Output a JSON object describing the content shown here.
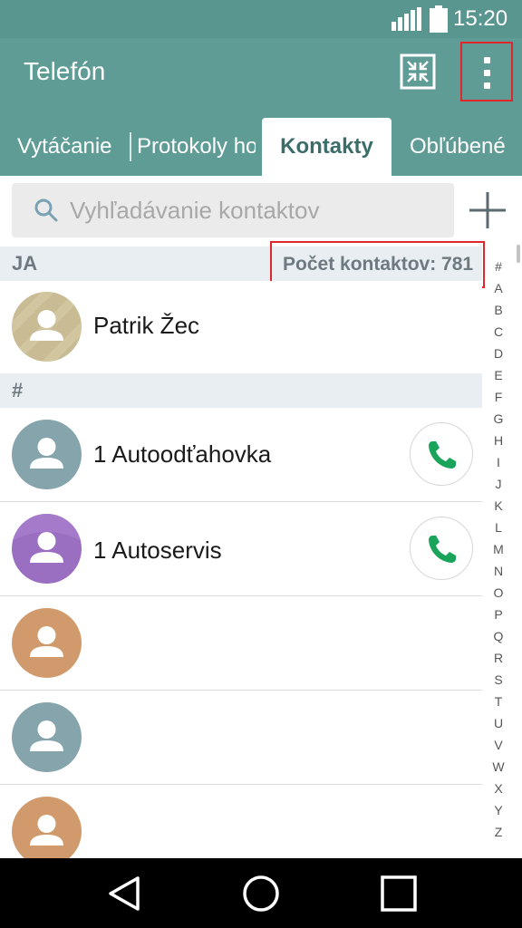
{
  "status_bar": {
    "time": "15:20"
  },
  "app_bar": {
    "title": "Telefón",
    "collapse_icon": "collapse-arrows-icon",
    "menu_icon": "more-vert-icon"
  },
  "tabs": [
    {
      "label": "Vytáčanie",
      "active": false
    },
    {
      "label": "Protokoly hovorov",
      "active": false
    },
    {
      "label": "Kontakty",
      "active": true
    },
    {
      "label": "Obľúbené",
      "active": false
    }
  ],
  "search": {
    "placeholder": "Vyhľadávanie kontaktov",
    "value": ""
  },
  "sections": [
    {
      "letter": "JA",
      "count_label": "Počet kontaktov: 781"
    },
    {
      "letter": "#"
    }
  ],
  "contacts": [
    {
      "name": "Patrik Žec",
      "avatar_color": "#c9bc94",
      "has_call": false
    },
    {
      "name": "1 Autoodťahovka",
      "avatar_color": "#86a4ac",
      "has_call": true
    },
    {
      "name": "1 Autoservis",
      "avatar_color": "#9a6ec0",
      "has_call": true
    },
    {
      "name": "",
      "avatar_color": "#d09a6c",
      "has_call": false
    },
    {
      "name": "",
      "avatar_color": "#86a4ac",
      "has_call": false
    },
    {
      "name": "",
      "avatar_color": "#d09a6c",
      "has_call": false
    }
  ],
  "alphabet": [
    "#",
    "A",
    "B",
    "C",
    "D",
    "E",
    "F",
    "G",
    "H",
    "I",
    "J",
    "K",
    "L",
    "M",
    "N",
    "O",
    "P",
    "Q",
    "R",
    "S",
    "T",
    "U",
    "V",
    "W",
    "X",
    "Y",
    "Z"
  ],
  "colors": {
    "primary": "#5f9c96",
    "status_bar": "#5a9690",
    "call_green": "#1aa35a",
    "highlight_red": "#e0272b"
  },
  "nav": {
    "back_icon": "back-triangle-icon",
    "home_icon": "home-circle-icon",
    "recents_icon": "recents-square-icon"
  }
}
